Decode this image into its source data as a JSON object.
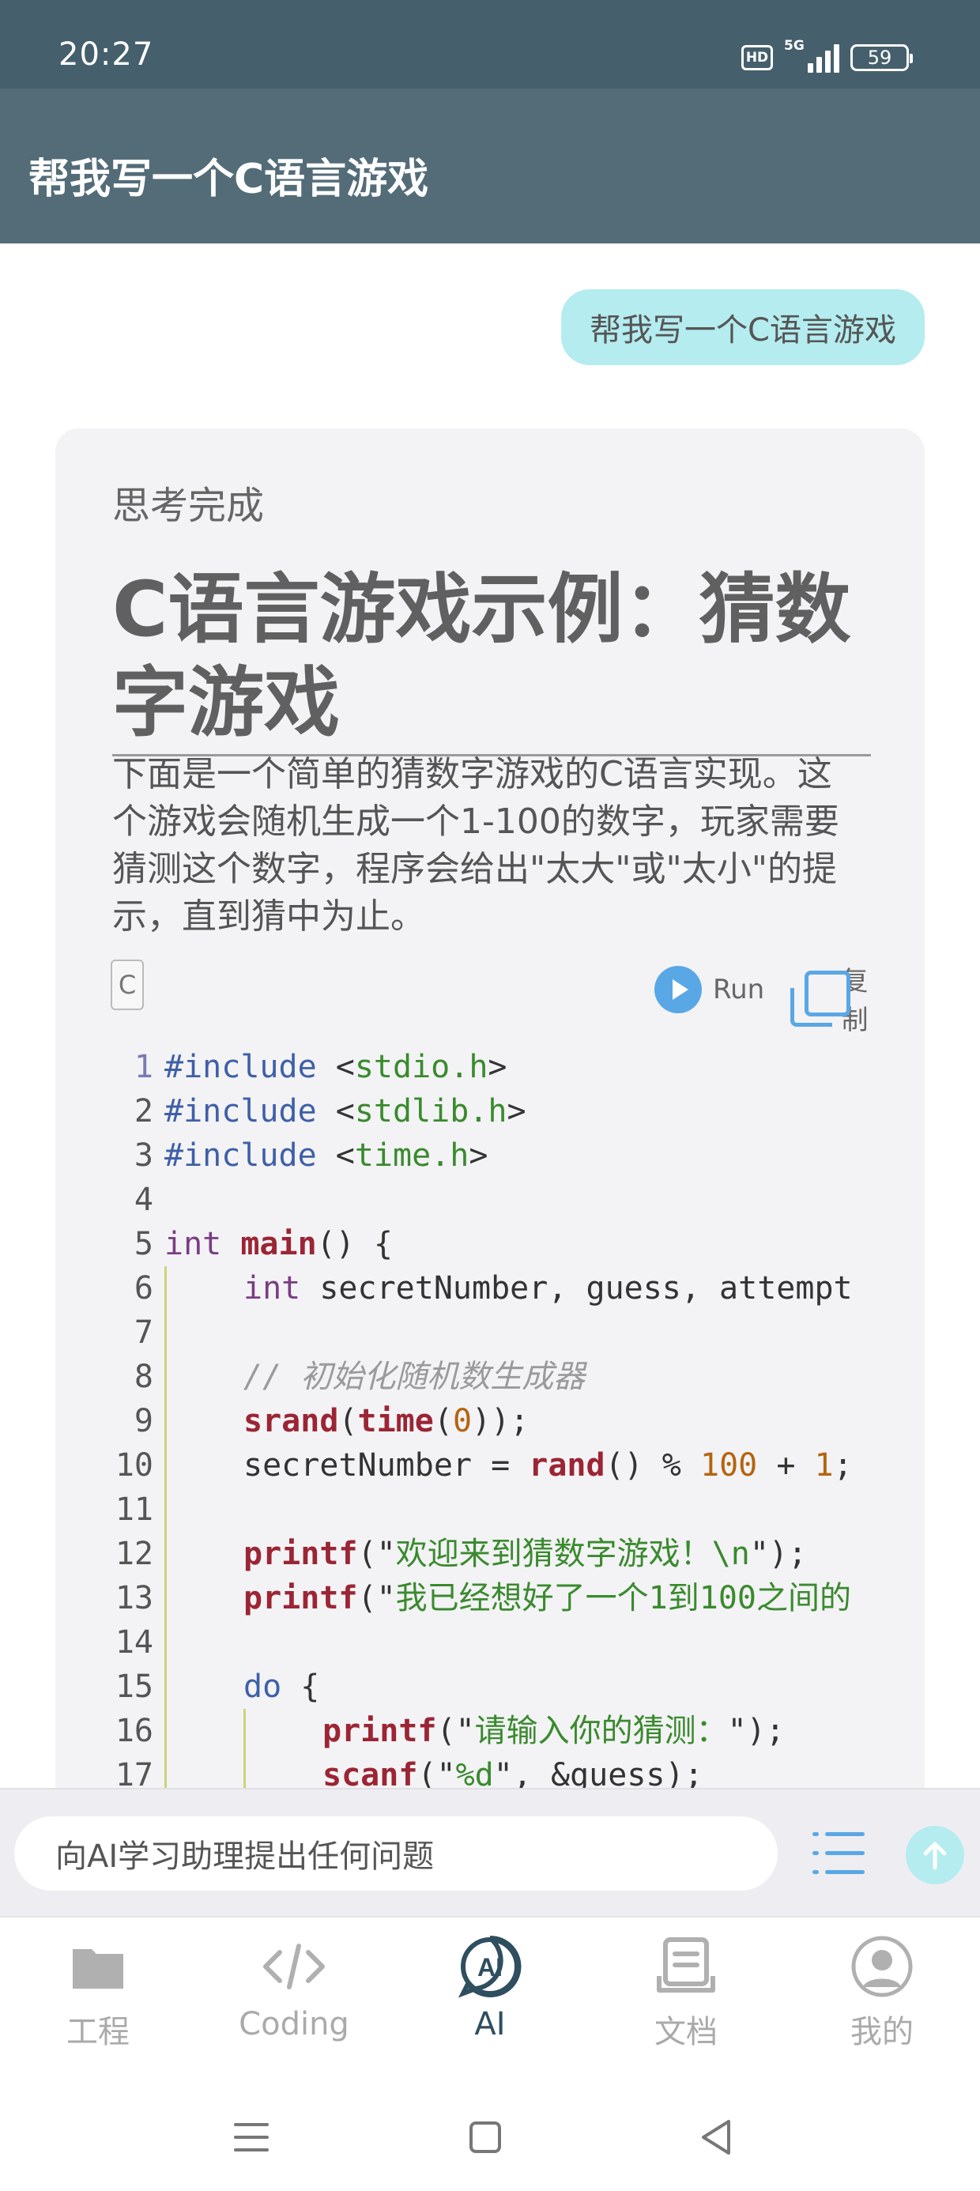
{
  "status_bar": {
    "time": "20:27",
    "hd": "HD",
    "network": "5G",
    "battery": "59"
  },
  "app_bar": {
    "title": "帮我写一个C语言游戏"
  },
  "conversation": {
    "user_message": "帮我写一个C语言游戏",
    "answer": {
      "status": "思考完成",
      "heading_line1": "C语言游戏示例：猜数",
      "heading_line2": "字游戏",
      "paragraph_lines": [
        "下面是一个简单的猜数字游戏的C语言实现。这",
        "个游戏会随机生成一个1-100的数字，玩家需要",
        "猜测这个数字，程序会给出\"太大\"或\"太小\"的提",
        "示，直到猜中为止。"
      ],
      "code_lang": "C",
      "run_label": "Run",
      "copy_label": "复制",
      "code_lines": [
        {
          "n": "1",
          "indent": 0,
          "tokens": [
            [
              "kw",
              "#include"
            ],
            [
              "pn",
              " <"
            ],
            [
              "str",
              "stdio.h"
            ],
            [
              "pn",
              ">"
            ]
          ]
        },
        {
          "n": "2",
          "indent": 0,
          "tokens": [
            [
              "kw",
              "#include"
            ],
            [
              "pn",
              " <"
            ],
            [
              "str",
              "stdlib.h"
            ],
            [
              "pn",
              ">"
            ]
          ]
        },
        {
          "n": "3",
          "indent": 0,
          "tokens": [
            [
              "kw",
              "#include"
            ],
            [
              "pn",
              " <"
            ],
            [
              "str",
              "time.h"
            ],
            [
              "pn",
              ">"
            ]
          ]
        },
        {
          "n": "4",
          "indent": 0,
          "tokens": []
        },
        {
          "n": "5",
          "indent": 0,
          "tokens": [
            [
              "type",
              "int"
            ],
            [
              "pn",
              " "
            ],
            [
              "fn",
              "main"
            ],
            [
              "pn",
              "() {"
            ]
          ]
        },
        {
          "n": "6",
          "indent": 1,
          "tokens": [
            [
              "type",
              "int"
            ],
            [
              "pn",
              " secretNumber, guess, attempt"
            ]
          ]
        },
        {
          "n": "7",
          "indent": 1,
          "tokens": []
        },
        {
          "n": "8",
          "indent": 1,
          "tokens": [
            [
              "cmt",
              "// 初始化随机数生成器"
            ]
          ]
        },
        {
          "n": "9",
          "indent": 1,
          "tokens": [
            [
              "fn",
              "srand"
            ],
            [
              "pn",
              "("
            ],
            [
              "fn",
              "time"
            ],
            [
              "pn",
              "("
            ],
            [
              "num",
              "0"
            ],
            [
              "pn",
              "));"
            ]
          ]
        },
        {
          "n": "10",
          "indent": 1,
          "tokens": [
            [
              "pn",
              "secretNumber = "
            ],
            [
              "fn",
              "rand"
            ],
            [
              "pn",
              "() % "
            ],
            [
              "num",
              "100"
            ],
            [
              "pn",
              " + "
            ],
            [
              "num",
              "1"
            ],
            [
              "pn",
              ";"
            ]
          ]
        },
        {
          "n": "11",
          "indent": 1,
          "tokens": []
        },
        {
          "n": "12",
          "indent": 1,
          "tokens": [
            [
              "fn",
              "printf"
            ],
            [
              "pn",
              "(\""
            ],
            [
              "str",
              "欢迎来到猜数字游戏！\\n"
            ],
            [
              "pn",
              "\");"
            ]
          ]
        },
        {
          "n": "13",
          "indent": 1,
          "tokens": [
            [
              "fn",
              "printf"
            ],
            [
              "pn",
              "(\""
            ],
            [
              "str",
              "我已经想好了一个1到100之间的"
            ]
          ]
        },
        {
          "n": "14",
          "indent": 1,
          "tokens": []
        },
        {
          "n": "15",
          "indent": 1,
          "tokens": [
            [
              "kw",
              "do"
            ],
            [
              "pn",
              " {"
            ]
          ]
        },
        {
          "n": "16",
          "indent": 2,
          "tokens": [
            [
              "fn",
              "printf"
            ],
            [
              "pn",
              "(\""
            ],
            [
              "str",
              "请输入你的猜测："
            ],
            [
              "pn",
              "\");"
            ]
          ]
        },
        {
          "n": "17",
          "indent": 2,
          "tokens": [
            [
              "fn",
              "scanf"
            ],
            [
              "pn",
              "(\""
            ],
            [
              "str",
              "%d"
            ],
            [
              "pn",
              "\", &guess);"
            ]
          ]
        }
      ]
    }
  },
  "input_bar": {
    "placeholder": "向AI学习助理提出任何问题"
  },
  "bottom_nav": {
    "items": [
      {
        "label": "工程",
        "icon": "folder-icon",
        "active": false
      },
      {
        "label": "Coding",
        "icon": "code-icon",
        "active": false
      },
      {
        "label": "AI",
        "icon": "ai-icon",
        "active": true
      },
      {
        "label": "文档",
        "icon": "document-icon",
        "active": false
      },
      {
        "label": "我的",
        "icon": "profile-icon",
        "active": false
      }
    ]
  },
  "colors": {
    "status_bar": "#455f6c",
    "app_bar": "#536c78",
    "user_bubble": "#b4ecef",
    "accent_blue": "#5aa7e6",
    "active_nav": "#2f4e5f"
  }
}
